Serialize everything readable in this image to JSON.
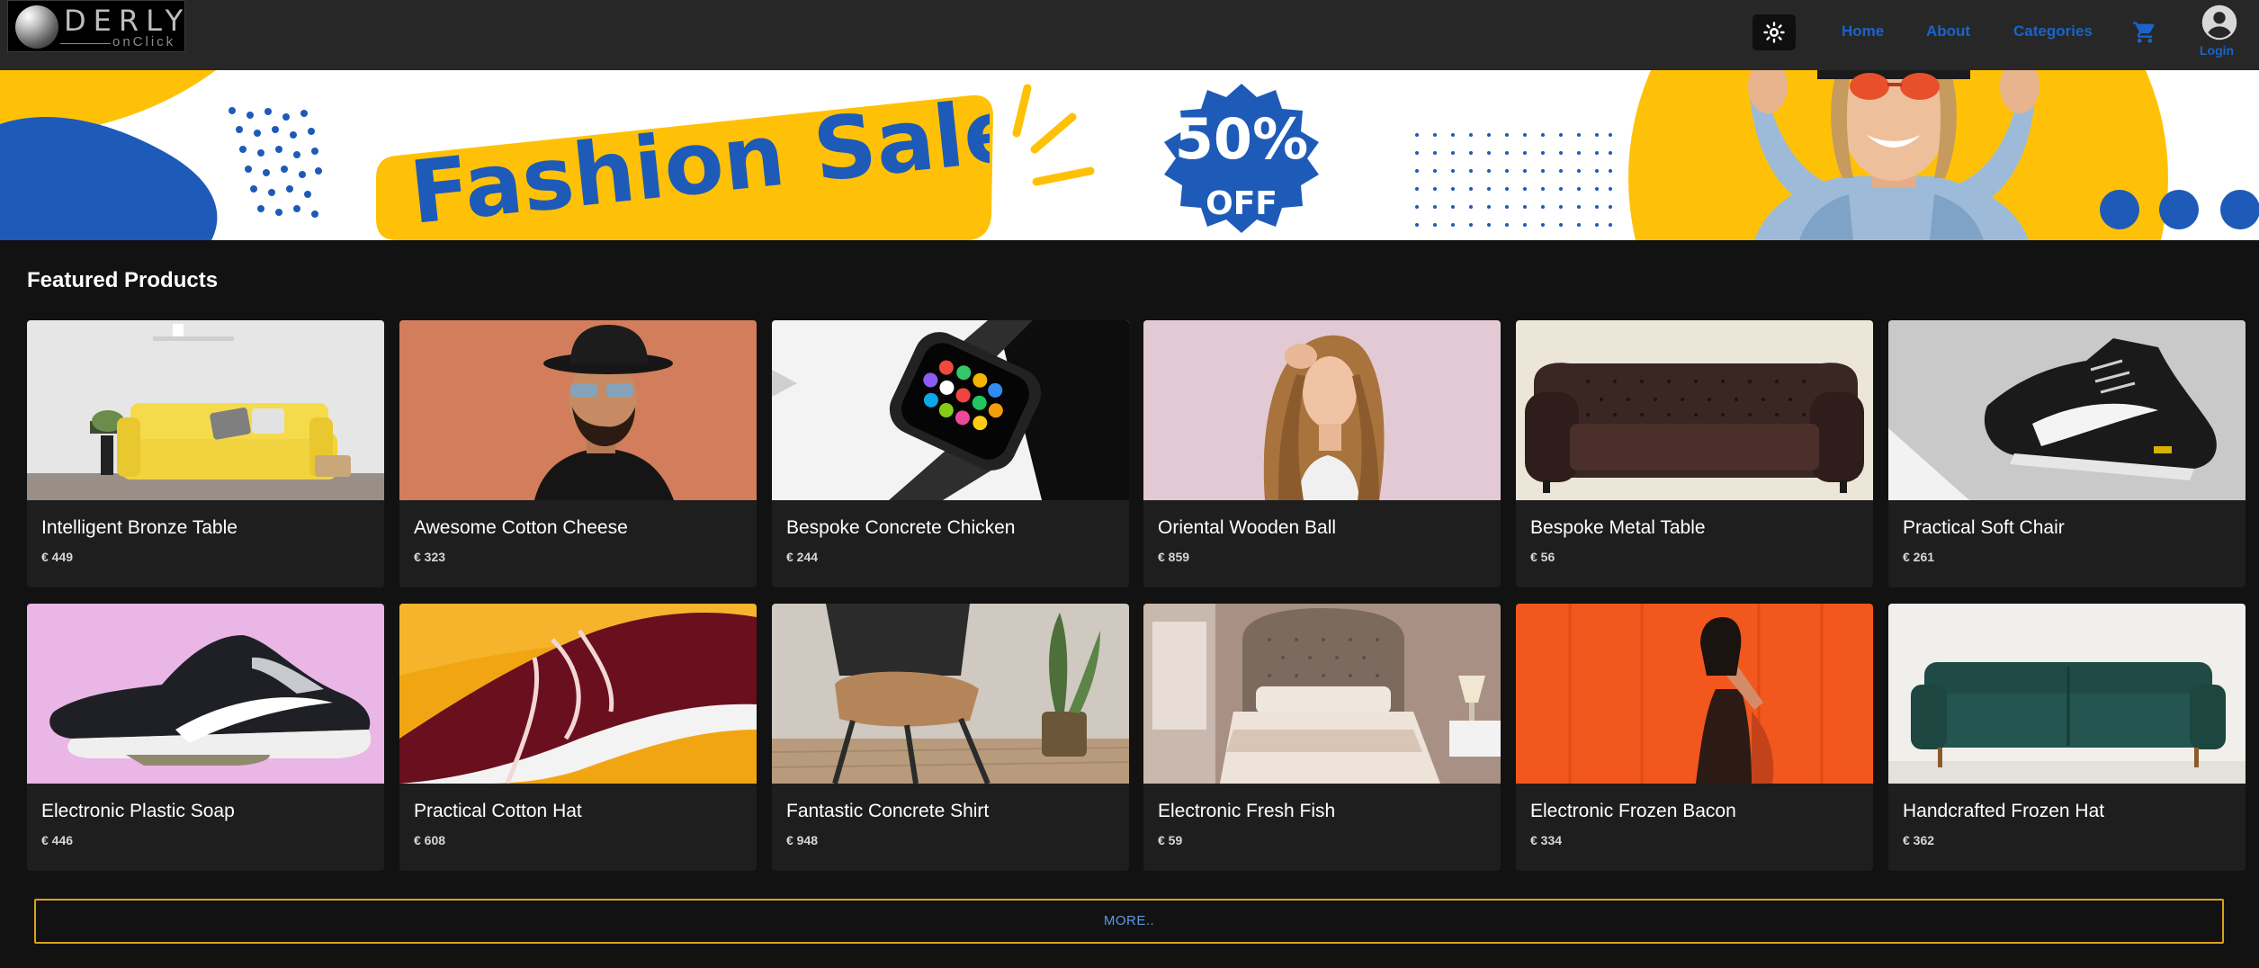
{
  "logo": {
    "main": "DERLY",
    "sub": "onClick"
  },
  "nav": {
    "theme_toggle_icon": "sun-icon",
    "links": [
      "Home",
      "About",
      "Categories"
    ],
    "cart_icon": "cart-icon",
    "login_label": "Login"
  },
  "banner": {
    "headline": "Fashion Sale",
    "badge_percent": "50%",
    "badge_off": "OFF",
    "colors": {
      "yellow": "#ffc107",
      "blue": "#1e5ab8"
    }
  },
  "featured": {
    "title": "Featured Products",
    "products": [
      {
        "name": "Intelligent Bronze Table",
        "price": "€ 449"
      },
      {
        "name": "Awesome Cotton Cheese",
        "price": "€ 323"
      },
      {
        "name": "Bespoke Concrete Chicken",
        "price": "€ 244"
      },
      {
        "name": "Oriental Wooden Ball",
        "price": "€ 859"
      },
      {
        "name": "Bespoke Metal Table",
        "price": "€ 56"
      },
      {
        "name": "Practical Soft Chair",
        "price": "€ 261"
      },
      {
        "name": "Electronic Plastic Soap",
        "price": "€ 446"
      },
      {
        "name": "Practical Cotton Hat",
        "price": "€ 608"
      },
      {
        "name": "Fantastic Concrete Shirt",
        "price": "€ 948"
      },
      {
        "name": "Electronic Fresh Fish",
        "price": "€ 59"
      },
      {
        "name": "Electronic Frozen Bacon",
        "price": "€ 334"
      },
      {
        "name": "Handcrafted Frozen Hat",
        "price": "€ 362"
      }
    ],
    "more_label": "MORE.."
  }
}
